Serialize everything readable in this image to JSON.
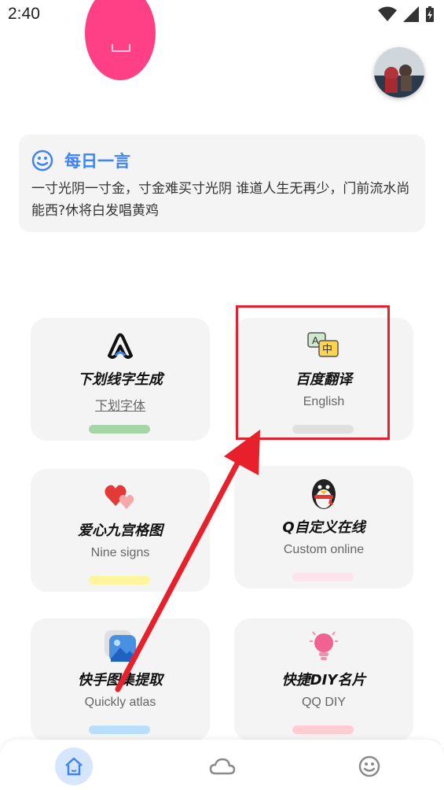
{
  "status_bar": {
    "time": "2:40"
  },
  "quote": {
    "title": "每日一言",
    "text": "一寸光阴一寸金，寸金难买寸光阴   谁道人生无再少，门前流水尚能西?休将白发唱黄鸡"
  },
  "cards": [
    {
      "title": "下划线字生成",
      "subtitle": "下划字体",
      "bar_color": "#a5d6a7",
      "icon": "link-loop-icon"
    },
    {
      "title": "百度翻译",
      "subtitle": "English",
      "bar_color": "#e0e0e0",
      "icon": "translate-icon"
    },
    {
      "title": "爱心九宫格图",
      "subtitle": "Nine signs",
      "bar_color": "#fff59d",
      "icon": "hearts-icon"
    },
    {
      "title": "Q自定义在线",
      "subtitle": "Custom online",
      "bar_color": "#fce4ec",
      "icon": "qq-penguin-icon"
    },
    {
      "title": "快手图集提取",
      "subtitle": "Quickly atlas",
      "bar_color": "#bbdefb",
      "icon": "image-gallery-icon"
    },
    {
      "title": "快捷DIY名片",
      "subtitle": "QQ DIY",
      "bar_color": "#ffcdd2",
      "icon": "lightbulb-icon"
    }
  ],
  "colors": {
    "accent": "#3e82f7",
    "annotation": "#e8202b",
    "card_bg": "#f4f4f4"
  },
  "bottom_nav": {
    "items": [
      "home-icon",
      "cloud-icon",
      "smile-icon"
    ],
    "active": "home-icon"
  }
}
